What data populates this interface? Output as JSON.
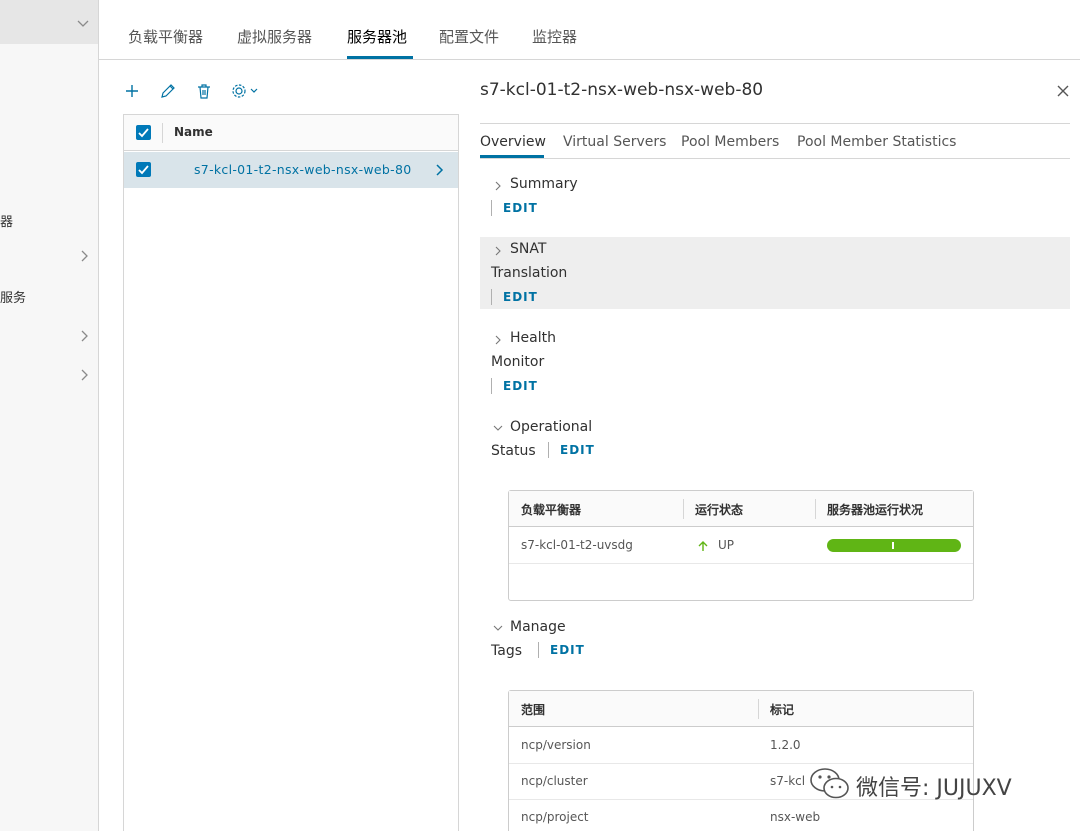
{
  "sidebar": {
    "items": [
      {
        "label": ""
      },
      {
        "label": "器"
      },
      {
        "label": ""
      },
      {
        "label": "服务"
      },
      {
        "label": ""
      },
      {
        "label": ""
      }
    ]
  },
  "top_tabs": [
    {
      "label": "负载平衡器"
    },
    {
      "label": "虚拟服务器"
    },
    {
      "label": "服务器池"
    },
    {
      "label": "配置文件"
    },
    {
      "label": "监控器"
    }
  ],
  "toolbar": {
    "add_icon": "plus-icon",
    "edit_icon": "pencil-icon",
    "delete_icon": "trash-icon",
    "settings_icon": "gear-icon"
  },
  "list": {
    "header": "Name",
    "rows": [
      {
        "name": "s7-kcl-01-t2-nsx-web-nsx-web-80"
      }
    ]
  },
  "detail": {
    "title": "s7-kcl-01-t2-nsx-web-nsx-web-80",
    "tabs": [
      {
        "label": "Overview"
      },
      {
        "label": "Virtual Servers"
      },
      {
        "label": "Pool Members"
      },
      {
        "label": "Pool Member Statistics"
      }
    ],
    "sections": {
      "summary": {
        "title": "Summary",
        "edit": "EDIT"
      },
      "snat": {
        "title": "SNAT",
        "title2": "Translation",
        "edit": "EDIT"
      },
      "health": {
        "title": "Health",
        "title2": "Monitor",
        "edit": "EDIT"
      },
      "operational": {
        "title": "Operational",
        "title2": "Status",
        "edit": "EDIT"
      },
      "manage": {
        "title": "Manage",
        "title2": "Tags",
        "edit": "EDIT"
      }
    },
    "status_table": {
      "headers": [
        "负载平衡器",
        "运行状态",
        "服务器池运行状况"
      ],
      "rows": [
        {
          "lb": "s7-kcl-01-t2-uvsdg",
          "status": "UP",
          "health_level": 1.0
        }
      ]
    },
    "tags_table": {
      "headers": [
        "范围",
        "标记"
      ],
      "rows": [
        {
          "scope": "ncp/version",
          "tag": "1.2.0"
        },
        {
          "scope": "ncp/cluster",
          "tag": "s7-kcl"
        },
        {
          "scope": "ncp/project",
          "tag": "nsx-web"
        }
      ]
    }
  },
  "watermark": {
    "text": "微信号: JUJUXV"
  },
  "colors": {
    "accent": "#0072a3",
    "up_green": "#60b515",
    "selected_row": "#d9e4ea"
  }
}
